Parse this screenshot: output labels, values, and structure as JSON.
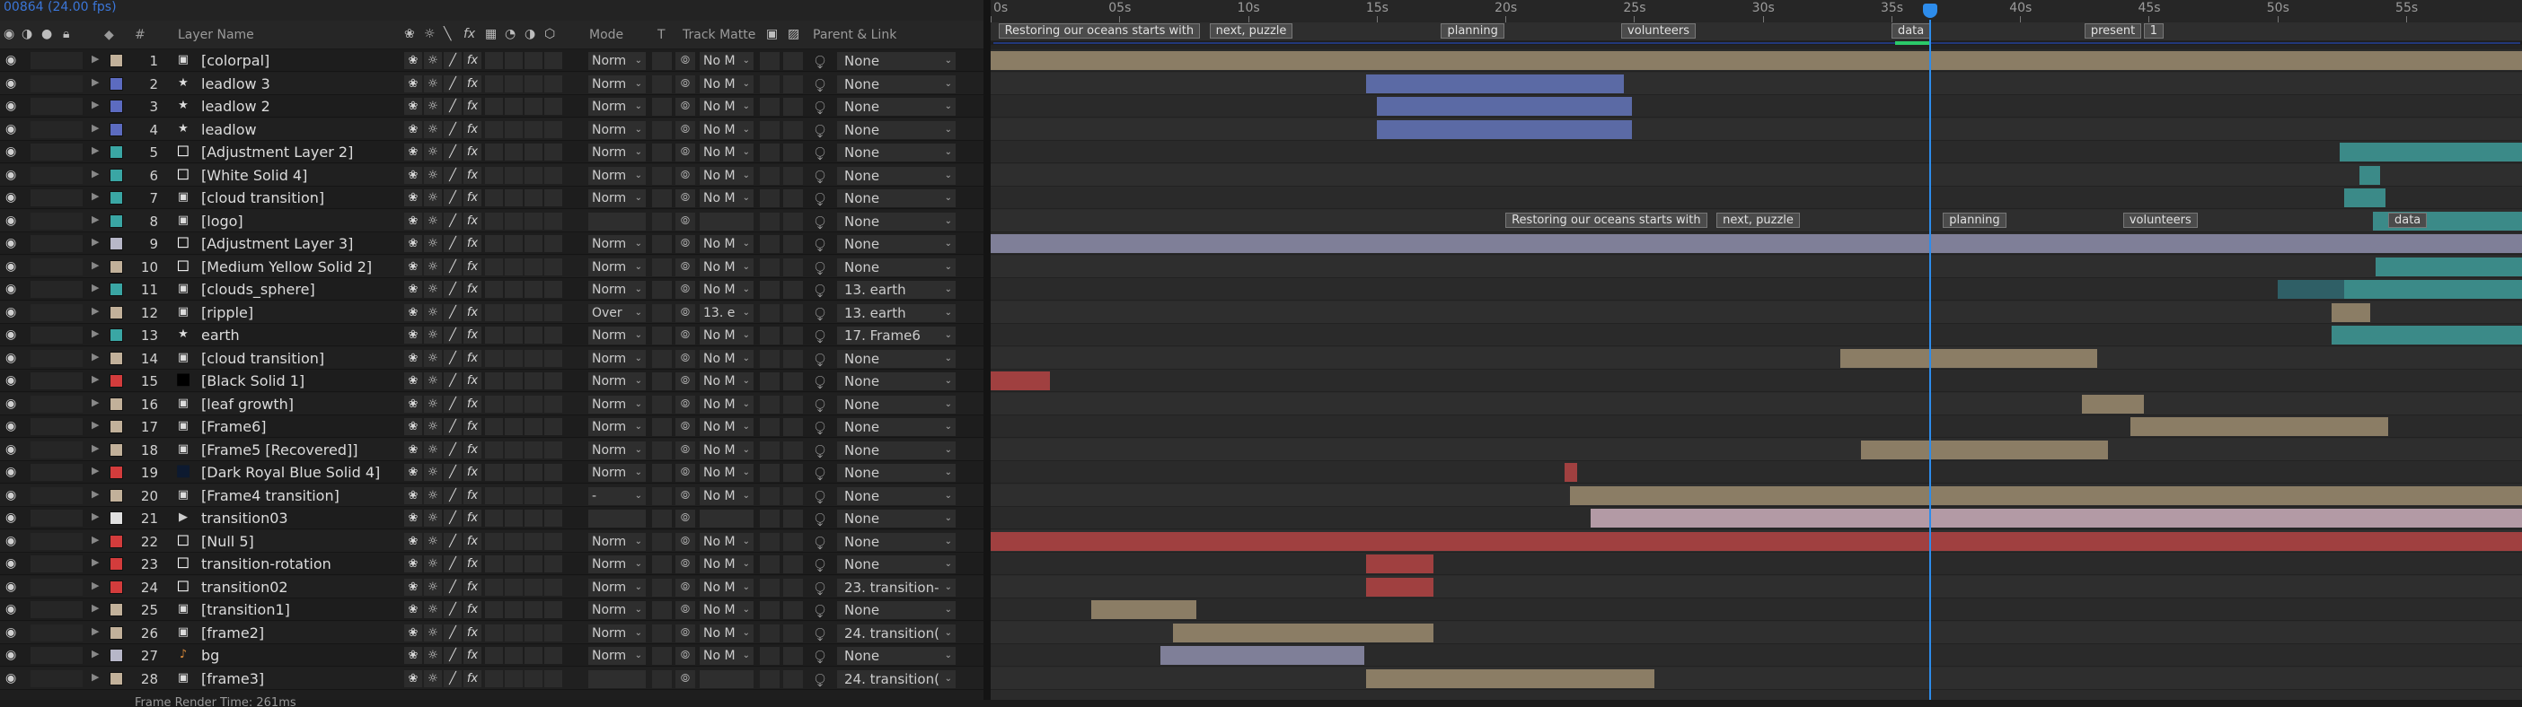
{
  "composition": {
    "frame_rate_label": "00864 (24.00 fps)"
  },
  "columns": {
    "label_tag": "◆",
    "number": "#",
    "layer_name": "Layer Name",
    "mode": "Mode",
    "t": "T",
    "track_matte": "Track Matte",
    "parent_link": "Parent & Link"
  },
  "ruler": {
    "ticks": [
      "0s",
      "05s",
      "10s",
      "15s",
      "20s",
      "25s",
      "30s",
      "35s",
      "40s",
      "45s",
      "50s",
      "55s"
    ],
    "start_seconds": 0,
    "end_seconds": 59.5,
    "current_time_seconds": 36.5
  },
  "comp_markers": [
    {
      "time": 0.3,
      "label": "Restoring our oceans starts with"
    },
    {
      "time": 8.5,
      "label": "next, puzzle"
    },
    {
      "time": 17.5,
      "label": "planning"
    },
    {
      "time": 24.5,
      "label": "volunteers"
    },
    {
      "time": 35.0,
      "label": "data"
    },
    {
      "time": 42.5,
      "label": "present"
    },
    {
      "time": 44.8,
      "label": "1"
    }
  ],
  "layers": [
    {
      "num": "1",
      "name": "[colorpal]",
      "type": "comp",
      "label": "#c2b19a",
      "mode": "Norm",
      "matte": "No M",
      "parent": "None",
      "bars": [
        {
          "s": 0.0,
          "e": 60,
          "c": "#8b7d65"
        }
      ]
    },
    {
      "num": "2",
      "name": "leadlow 3",
      "type": "star",
      "label": "#5c6bc0",
      "mode": "Norm",
      "matte": "No M",
      "parent": "None",
      "bars": [
        {
          "s": 14.6,
          "e": 24.6,
          "c": "#5b6aa5"
        }
      ]
    },
    {
      "num": "3",
      "name": "leadlow 2",
      "type": "star",
      "label": "#5c6bc0",
      "mode": "Norm",
      "matte": "No M",
      "parent": "None",
      "bars": [
        {
          "s": 15.0,
          "e": 24.9,
          "c": "#5b6aa5"
        }
      ]
    },
    {
      "num": "4",
      "name": "leadlow",
      "type": "star",
      "label": "#5c6bc0",
      "mode": "Norm",
      "matte": "No M",
      "parent": "None",
      "bars": [
        {
          "s": 15.0,
          "e": 24.9,
          "c": "#5b6aa5"
        }
      ]
    },
    {
      "num": "5",
      "name": "[Adjustment Layer 2]",
      "type": "solid",
      "label": "#3aa6a4",
      "mode": "Norm",
      "matte": "No M",
      "parent": "None",
      "bars": [
        {
          "s": 52.4,
          "e": 60,
          "c": "#3b8a88"
        }
      ]
    },
    {
      "num": "6",
      "name": "[White Solid 4]",
      "type": "solid",
      "label": "#3aa6a4",
      "mode": "Norm",
      "matte": "No M",
      "parent": "None",
      "bars": [
        {
          "s": 53.2,
          "e": 54.0,
          "c": "#3b8a88"
        }
      ]
    },
    {
      "num": "7",
      "name": "[cloud transition]",
      "type": "comp",
      "label": "#3aa6a4",
      "mode": "Norm",
      "matte": "No M",
      "parent": "None",
      "bars": [
        {
          "s": 52.6,
          "e": 54.2,
          "c": "#3b8a88"
        }
      ]
    },
    {
      "num": "8",
      "name": "[logo]",
      "type": "comp",
      "label": "#3aa6a4",
      "mode": "",
      "matte": "",
      "parent": "None",
      "bars": [
        {
          "s": 53.7,
          "e": 60,
          "c": "#3b8a88"
        }
      ]
    },
    {
      "num": "9",
      "name": "[Adjustment Layer 3]",
      "type": "solid",
      "label": "#b7b7c8",
      "mode": "Norm",
      "matte": "No M",
      "parent": "None",
      "bars": [
        {
          "s": 0.0,
          "e": 60,
          "c": "#7f7f98"
        }
      ]
    },
    {
      "num": "10",
      "name": "[Medium Yellow Solid 2]",
      "type": "solid",
      "label": "#c2b19a",
      "mode": "Norm",
      "matte": "No M",
      "parent": "None",
      "bars": [
        {
          "s": 53.8,
          "e": 60,
          "c": "#3b8a88"
        }
      ]
    },
    {
      "num": "11",
      "name": "[clouds_sphere]",
      "type": "comp",
      "label": "#3aa6a4",
      "mode": "Norm",
      "matte": "No M",
      "parent": "13. earth",
      "bars": [
        {
          "s": 50.0,
          "e": 52.6,
          "c": "#2f5f66"
        },
        {
          "s": 52.6,
          "e": 60,
          "c": "#3b8a88"
        }
      ]
    },
    {
      "num": "12",
      "name": "[ripple]",
      "type": "comp",
      "label": "#c2b19a",
      "mode": "Over",
      "matte": "13. e",
      "parent": "13. earth",
      "bars": [
        {
          "s": 52.1,
          "e": 53.6,
          "c": "#8b7d65"
        }
      ]
    },
    {
      "num": "13",
      "name": "earth",
      "type": "star",
      "label": "#3aa6a4",
      "mode": "Norm",
      "matte": "No M",
      "parent": "17. Frame6",
      "bars": [
        {
          "s": 52.1,
          "e": 60,
          "c": "#3b8a88"
        }
      ]
    },
    {
      "num": "14",
      "name": "[cloud transition]",
      "type": "comp",
      "label": "#c2b19a",
      "mode": "Norm",
      "matte": "No M",
      "parent": "None",
      "bars": [
        {
          "s": 33.0,
          "e": 43.0,
          "c": "#8b7d65"
        }
      ]
    },
    {
      "num": "15",
      "name": "[Black Solid 1]",
      "type": "solid-black",
      "label": "#d33c3c",
      "mode": "Norm",
      "matte": "No M",
      "parent": "None",
      "bars": [
        {
          "s": 0.0,
          "e": 2.3,
          "c": "#a04040"
        }
      ]
    },
    {
      "num": "16",
      "name": "[leaf growth]",
      "type": "comp",
      "label": "#c2b19a",
      "mode": "Norm",
      "matte": "No M",
      "parent": "None",
      "bars": [
        {
          "s": 42.4,
          "e": 44.8,
          "c": "#8b7d65"
        }
      ]
    },
    {
      "num": "17",
      "name": "[Frame6]",
      "type": "comp",
      "label": "#c2b19a",
      "mode": "Norm",
      "matte": "No M",
      "parent": "None",
      "bars": [
        {
          "s": 44.3,
          "e": 54.3,
          "c": "#8b7d65"
        }
      ]
    },
    {
      "num": "18",
      "name": "[Frame5 [Recovered]]",
      "type": "comp",
      "label": "#c2b19a",
      "mode": "Norm",
      "matte": "No M",
      "parent": "None",
      "bars": [
        {
          "s": 33.8,
          "e": 43.4,
          "c": "#8b7d65"
        }
      ]
    },
    {
      "num": "19",
      "name": "[Dark Royal Blue Solid 4]",
      "type": "solid-dark",
      "label": "#d33c3c",
      "mode": "Norm",
      "matte": "No M",
      "parent": "None",
      "bars": [
        {
          "s": 22.3,
          "e": 22.8,
          "c": "#a04040"
        }
      ]
    },
    {
      "num": "20",
      "name": "[Frame4 transition]",
      "type": "comp",
      "label": "#c2b19a",
      "mode": "-",
      "matte": "No M",
      "parent": "None",
      "bars": [
        {
          "s": 22.5,
          "e": 60,
          "c": "#8b7d65"
        }
      ]
    },
    {
      "num": "21",
      "name": "transition03",
      "type": "camera",
      "label": "#e0e0e0",
      "mode": "",
      "matte": "",
      "parent": "None",
      "bars": [
        {
          "s": 23.3,
          "e": 60,
          "c": "#b39aa5"
        }
      ]
    },
    {
      "num": "22",
      "name": "[Null 5]",
      "type": "solid",
      "label": "#d33c3c",
      "mode": "Norm",
      "matte": "No M",
      "parent": "None",
      "bars": [
        {
          "s": 0.0,
          "e": 60,
          "c": "#a04040"
        }
      ]
    },
    {
      "num": "23",
      "name": "transition-rotation",
      "type": "solid",
      "label": "#d33c3c",
      "mode": "Norm",
      "matte": "No M",
      "parent": "None",
      "bars": [
        {
          "s": 14.6,
          "e": 17.2,
          "c": "#a04040"
        }
      ]
    },
    {
      "num": "24",
      "name": "transition02",
      "type": "solid",
      "label": "#d33c3c",
      "mode": "Norm",
      "matte": "No M",
      "parent": "23. transition-",
      "bars": [
        {
          "s": 14.6,
          "e": 17.2,
          "c": "#a04040"
        }
      ]
    },
    {
      "num": "25",
      "name": "[transition1]",
      "type": "comp",
      "label": "#c2b19a",
      "mode": "Norm",
      "matte": "No M",
      "parent": "None",
      "bars": [
        {
          "s": 3.9,
          "e": 8.0,
          "c": "#8b7d65"
        }
      ]
    },
    {
      "num": "26",
      "name": "[frame2]",
      "type": "comp",
      "label": "#c2b19a",
      "mode": "Norm",
      "matte": "No M",
      "parent": "24. transition(",
      "bars": [
        {
          "s": 7.1,
          "e": 17.2,
          "c": "#8b7d65"
        }
      ]
    },
    {
      "num": "27",
      "name": "bg",
      "type": "audio",
      "label": "#b7b7c8",
      "mode": "Norm",
      "matte": "No M",
      "parent": "None",
      "bars": [
        {
          "s": 6.6,
          "e": 14.5,
          "c": "#7f7f98"
        }
      ]
    },
    {
      "num": "28",
      "name": "[frame3]",
      "type": "comp",
      "label": "#c2b19a",
      "mode": "",
      "matte": "",
      "parent": "24. transition(",
      "bars": [
        {
          "s": 14.6,
          "e": 25.8,
          "c": "#8b7d65"
        }
      ]
    }
  ],
  "layer_markers": {
    "row": 7,
    "items": [
      {
        "time": 20.0,
        "label": "Restoring our oceans starts with"
      },
      {
        "time": 28.2,
        "label": "next, puzzle"
      },
      {
        "time": 37.0,
        "label": "planning"
      },
      {
        "time": 44.0,
        "label": "volunteers"
      },
      {
        "time": 54.3,
        "label": "data"
      }
    ]
  },
  "footer": {
    "frame_render_time": "Frame Render Time: 261ms"
  },
  "colors": {
    "cti": "#2d8ceb",
    "accent": "#3b76d8"
  }
}
